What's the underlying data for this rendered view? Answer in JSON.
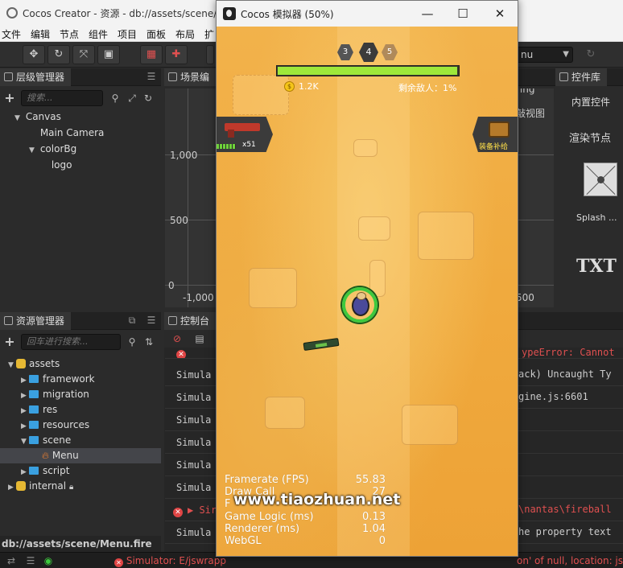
{
  "editor": {
    "title": "Cocos Creator - 资源 - db://assets/scene/Menu.fire",
    "menu": [
      "文件",
      "编辑",
      "节点",
      "组件",
      "项目",
      "面板",
      "布局",
      "扩"
    ],
    "scene_select": "nu"
  },
  "hierarchy": {
    "title": "层级管理器",
    "search_placeholder": "搜索...",
    "nodes": [
      {
        "label": "Canvas",
        "depth": 0,
        "arrow": "▼"
      },
      {
        "label": "Main Camera",
        "depth": 1,
        "arrow": ""
      },
      {
        "label": "colorBg",
        "depth": 1,
        "arrow": "▼"
      },
      {
        "label": "logo",
        "depth": 2,
        "arrow": ""
      }
    ]
  },
  "scene": {
    "title": "场景编",
    "y_labels": [
      "1,000",
      "500",
      "0"
    ],
    "x_labels": [
      "-1,000",
      "500"
    ],
    "side_labels": [
      "ring",
      "敲视图"
    ]
  },
  "assets": {
    "title": "资源管理器",
    "search_placeholder": "回车进行搜索...",
    "items": [
      {
        "label": "assets",
        "depth": 0,
        "arrow": "▼",
        "type": "db"
      },
      {
        "label": "framework",
        "depth": 1,
        "arrow": "▶",
        "type": "folder"
      },
      {
        "label": "migration",
        "depth": 1,
        "arrow": "▶",
        "type": "folder"
      },
      {
        "label": "res",
        "depth": 1,
        "arrow": "▶",
        "type": "folder"
      },
      {
        "label": "resources",
        "depth": 1,
        "arrow": "▶",
        "type": "folder"
      },
      {
        "label": "scene",
        "depth": 1,
        "arrow": "▼",
        "type": "folder"
      },
      {
        "label": "Menu",
        "depth": 2,
        "arrow": "",
        "type": "fire"
      },
      {
        "label": "script",
        "depth": 1,
        "arrow": "▶",
        "type": "folder"
      },
      {
        "label": "internal",
        "depth": 0,
        "arrow": "▶",
        "type": "db"
      }
    ],
    "path": "db://assets/scene/Menu.fire"
  },
  "console": {
    "title": "控制台",
    "lines": [
      {
        "left": "Simula",
        "right": "ack) Uncaught Ty",
        "error": false
      },
      {
        "left": "Simula",
        "right": "gine.js:6601",
        "error": false
      },
      {
        "left": "Simula",
        "right": "",
        "error": false
      },
      {
        "left": "Simula",
        "right": "",
        "error": false
      },
      {
        "left": "Simula",
        "right": "",
        "error": false
      },
      {
        "left": "Simula",
        "right": "",
        "error": false
      },
      {
        "left": "Sir",
        "right": "\\nantas\\fireball",
        "error": true
      },
      {
        "left": "Simula",
        "right": "he property text",
        "error": false
      }
    ],
    "top_error_right": "ypeError: Cannot",
    "status_error": "Simulator: E/jswrapp",
    "status_error_right": "on' of null, location: jsb-ad"
  },
  "library": {
    "title": "控件库",
    "builtin": "内置控件",
    "render_node": "渲染节点",
    "splash_label": "Splash ...",
    "txt_label": "TXT"
  },
  "simulator": {
    "title": "Cocos 模拟器 (50%)",
    "waves": [
      "3",
      "4",
      "5"
    ],
    "hp_fraction": 0.995,
    "coins": "1.2K",
    "enemies_remaining": "剩余敌人：1%",
    "ammo": "x51",
    "supply_label": "装备补给",
    "stats": [
      {
        "label": "Framerate (FPS)",
        "value": "55.83"
      },
      {
        "label": "Draw Call",
        "value": "27"
      },
      {
        "label": "F",
        "value": ""
      },
      {
        "label": "Game Logic (ms)",
        "value": "0.13"
      },
      {
        "label": "Renderer (ms)",
        "value": "1.04"
      },
      {
        "label": "WebGL",
        "value": "0"
      }
    ]
  },
  "watermark": "www.tiaozhuan.net"
}
